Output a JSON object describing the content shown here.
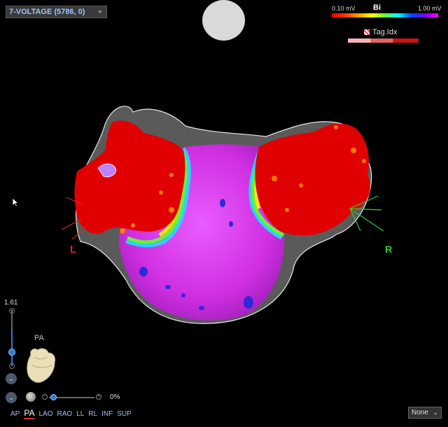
{
  "map_selector": {
    "label": "7-VOLTAGE (5786, 0)",
    "caret": "⌄"
  },
  "scale": {
    "min": "0.10 mV",
    "title": "Bi",
    "max": "1.00 mV"
  },
  "tag_index": {
    "label": "Tag.Idx"
  },
  "markers": {
    "left": "L",
    "right": "R"
  },
  "zoom": {
    "value": "1.61",
    "plus": "+",
    "minus": "-"
  },
  "orientation": {
    "label": "PA"
  },
  "opacity": {
    "value": "0%",
    "plus": "+",
    "minus": "-"
  },
  "views": {
    "ap": "AP",
    "pa": "PA",
    "lao": "LAO",
    "rao": "RAO",
    "ll": "LL",
    "rl": "RL",
    "inf": "INF",
    "sup": "SUP"
  },
  "view_filter": {
    "value": "None",
    "caret": "⌄"
  },
  "nav": {
    "down1": "⌄",
    "down2": "⌄"
  },
  "colors": {
    "red": "#e00000",
    "magenta": "#e032e8",
    "accent": "#2a7bd6"
  }
}
